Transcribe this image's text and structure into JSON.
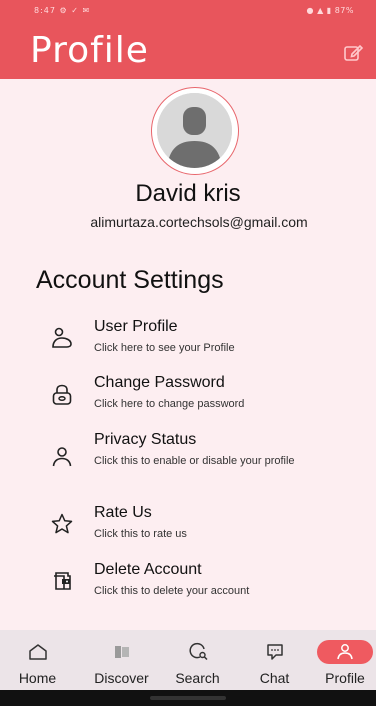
{
  "status_bar": {
    "time": "8:47",
    "indicators": "⚙ ✓ ✉",
    "right": "● ▲ ▮ 87%"
  },
  "app_bar": {
    "title": "Profile",
    "edit_icon": "edit-icon"
  },
  "profile": {
    "name": "David kris",
    "email": "alimurtaza.cortechsols@gmail.com"
  },
  "section": {
    "heading": "Account Settings"
  },
  "settings": [
    {
      "icon": "user-profile-icon",
      "title": "User Profile",
      "subtitle": "Click here to see your Profile"
    },
    {
      "icon": "lock-icon",
      "title": "Change Password",
      "subtitle": "Click here to change password"
    },
    {
      "icon": "person-icon",
      "title": "Privacy Status",
      "subtitle": "Click this to enable or disable your profile"
    },
    {
      "icon": "star-icon",
      "title": "Rate Us",
      "subtitle": "Click this to rate us"
    },
    {
      "icon": "delete-account-icon",
      "title": "Delete Account",
      "subtitle": "Click this to delete your account"
    }
  ],
  "bottom_nav": {
    "active": "Profile",
    "accent": "#ef5a60",
    "items": [
      {
        "label": "Home",
        "icon": "home-icon"
      },
      {
        "label": "Discover",
        "icon": "discover-icon"
      },
      {
        "label": "Search",
        "icon": "search-icon"
      },
      {
        "label": "Chat",
        "icon": "chat-icon"
      },
      {
        "label": "Profile",
        "icon": "profile-icon"
      }
    ]
  },
  "colors": {
    "primary": "#e8555c",
    "background": "#fdeef1",
    "nav_background": "#ece4e8"
  }
}
